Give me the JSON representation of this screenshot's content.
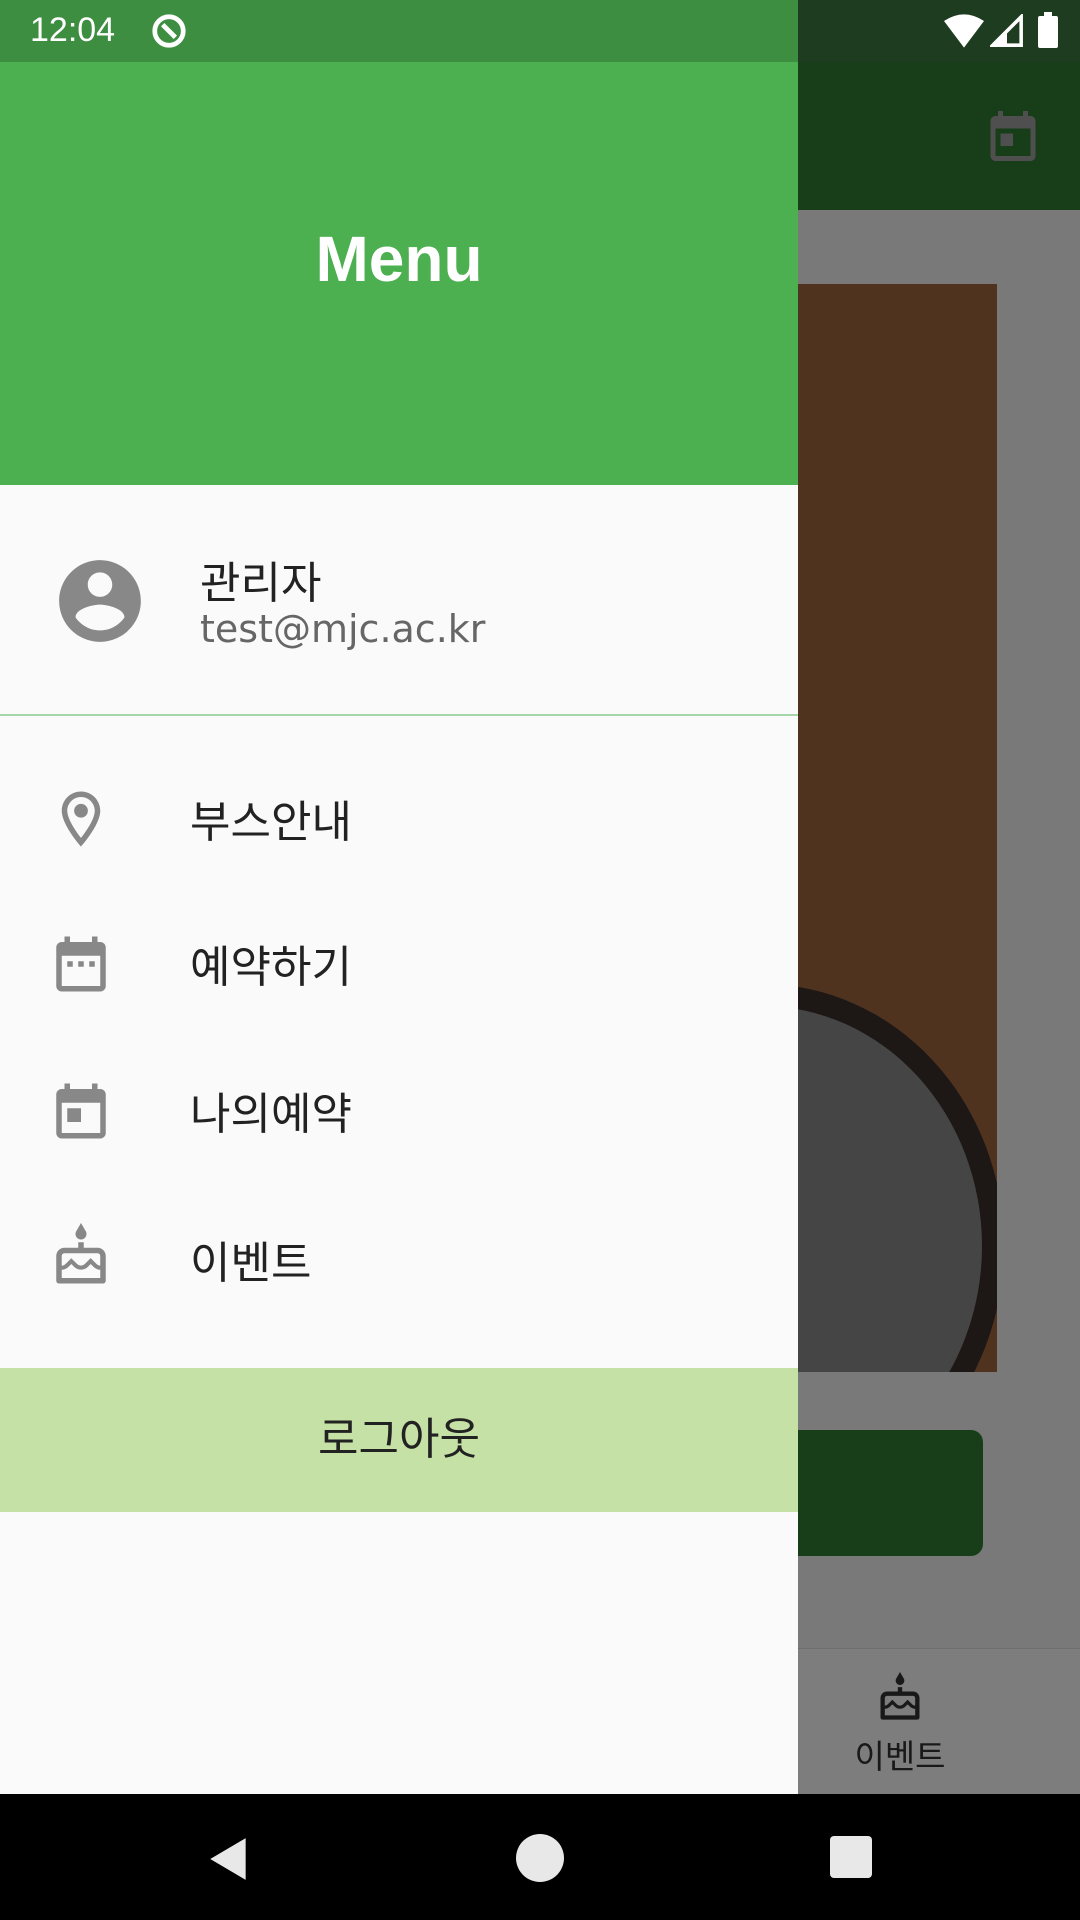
{
  "status_bar": {
    "time": "12:04"
  },
  "background_app": {
    "bottom_nav_label": "이벤트"
  },
  "drawer": {
    "header_title": "Menu",
    "profile": {
      "name": "관리자",
      "email": "test@mjc.ac.kr"
    },
    "items": [
      {
        "label": "부스안내",
        "icon": "location-pin-icon"
      },
      {
        "label": "예약하기",
        "icon": "calendar-icon"
      },
      {
        "label": "나의예약",
        "icon": "calendar-event-icon"
      },
      {
        "label": "이벤트",
        "icon": "cake-icon"
      }
    ],
    "logout_label": "로그아웃"
  },
  "colors": {
    "header_green": "#4caf50",
    "status_green": "#3e8e41",
    "logout_bg": "#c5e1a5",
    "divider": "#a5d6a7"
  }
}
